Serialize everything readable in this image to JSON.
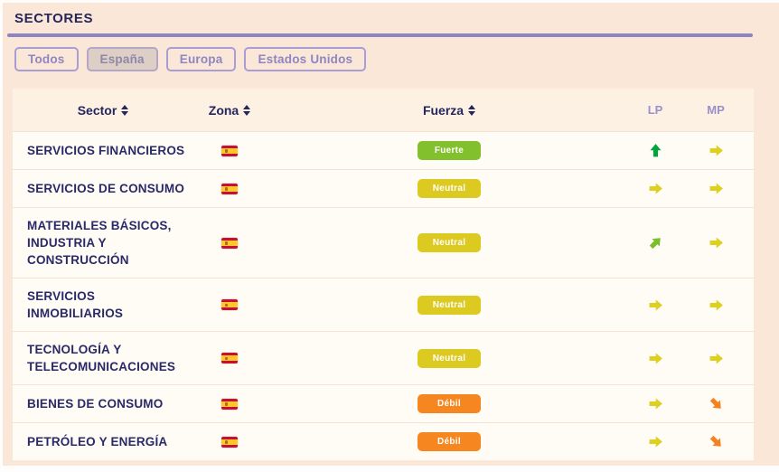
{
  "page": {
    "title": "SECTORES",
    "background_color": "#fae7d7",
    "accent_color": "#8c84c4"
  },
  "filters": {
    "items": [
      {
        "label": "Todos",
        "active": false
      },
      {
        "label": "España",
        "active": true
      },
      {
        "label": "Europa",
        "active": false
      },
      {
        "label": "Estados Unidos",
        "active": false
      }
    ]
  },
  "table": {
    "columns": [
      {
        "key": "sector",
        "label": "Sector",
        "sortable": true
      },
      {
        "key": "zona",
        "label": "Zona",
        "sortable": true
      },
      {
        "key": "fuerza",
        "label": "Fuerza",
        "sortable": true
      },
      {
        "key": "lp",
        "label": "LP",
        "sortable": false
      },
      {
        "key": "mp",
        "label": "MP",
        "sortable": false
      }
    ],
    "badge_colors": {
      "Fuerte": "#82c12d",
      "Neutral": "#ddca20",
      "Débil": "#f6861f"
    },
    "arrow_colors": {
      "up": "#00a33e",
      "up-right": "#7cbd2a",
      "right": "#ddd020",
      "down-right": "#f5821f"
    },
    "rows": [
      {
        "sector": "SERVICIOS FINANCIEROS",
        "zona": "España",
        "zona_icon": "spain-flag",
        "fuerza": "Fuerte",
        "lp": "up",
        "mp": "right"
      },
      {
        "sector": "SERVICIOS DE CONSUMO",
        "zona": "España",
        "zona_icon": "spain-flag",
        "fuerza": "Neutral",
        "lp": "right",
        "mp": "right"
      },
      {
        "sector": "MATERIALES BÁSICOS,\nINDUSTRIA Y\nCONSTRUCCIÓN",
        "zona": "España",
        "zona_icon": "spain-flag",
        "fuerza": "Neutral",
        "lp": "up-right",
        "mp": "right"
      },
      {
        "sector": "SERVICIOS\nINMOBILIARIOS",
        "zona": "España",
        "zona_icon": "spain-flag",
        "fuerza": "Neutral",
        "lp": "right",
        "mp": "right"
      },
      {
        "sector": "TECNOLOGÍA Y\nTELECOMUNICACIONES",
        "zona": "España",
        "zona_icon": "spain-flag",
        "fuerza": "Neutral",
        "lp": "right",
        "mp": "right"
      },
      {
        "sector": "BIENES DE CONSUMO",
        "zona": "España",
        "zona_icon": "spain-flag",
        "fuerza": "Débil",
        "lp": "right",
        "mp": "down-right"
      },
      {
        "sector": "PETRÓLEO Y ENERGÍA",
        "zona": "España",
        "zona_icon": "spain-flag",
        "fuerza": "Débil",
        "lp": "right",
        "mp": "down-right"
      }
    ]
  }
}
